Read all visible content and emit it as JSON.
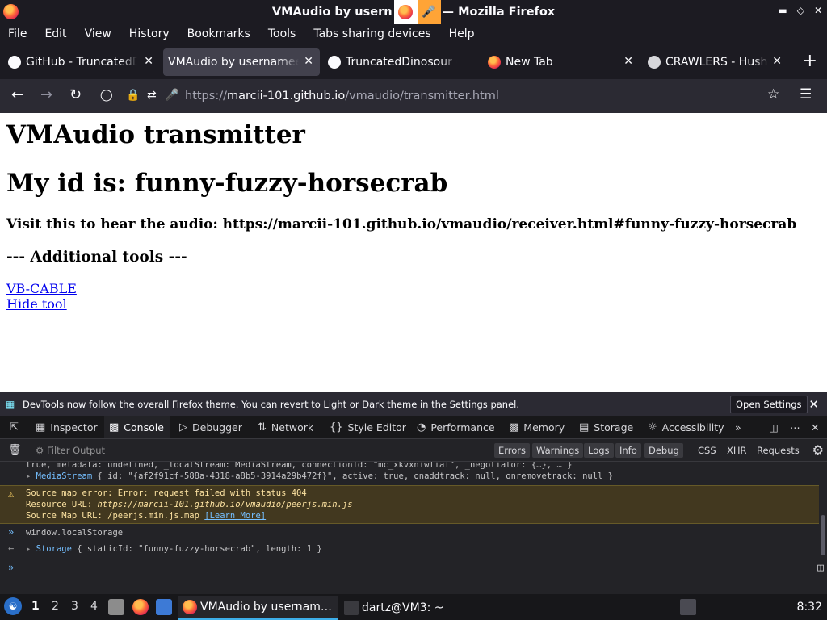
{
  "window": {
    "title_left": "VMAudio by usern",
    "title_right": "— Mozilla Firefox",
    "minimize": "•",
    "maximize": "•",
    "close": "✕"
  },
  "menu": [
    "File",
    "Edit",
    "View",
    "History",
    "Bookmarks",
    "Tools",
    "Tabs sharing devices",
    "Help"
  ],
  "tabs": [
    {
      "label": "GitHub - TruncatedDi",
      "icon": "github-icon",
      "active": false
    },
    {
      "label": "VMAudio by usernamee",
      "icon": "none",
      "active": true
    },
    {
      "label": "TruncatedDinosour (T",
      "icon": "github-icon",
      "active": false
    },
    {
      "label": "New Tab",
      "icon": "firefox-icon",
      "active": false
    },
    {
      "label": "CRAWLERS - Hush (O",
      "icon": "site-icon",
      "active": false
    }
  ],
  "url": {
    "scheme": "https://",
    "host": "marcii-101.github.io",
    "path": "/vmaudio/transmitter.html"
  },
  "page": {
    "heading": "VMAudio transmitter",
    "id_line": "My id is: funny-fuzzy-horsecrab",
    "visit_line": "Visit this to hear the audio: https://marcii-101.github.io/vmaudio/receiver.html#funny-fuzzy-horsecrab",
    "tools_heading": "--- Additional tools ---",
    "link_vbcable": "VB-CABLE",
    "link_hide": "Hide tool"
  },
  "devtools": {
    "notice": "DevTools now follow the overall Firefox theme. You can revert to Light or Dark theme in the Settings panel.",
    "open_settings": "Open Settings",
    "tabs": [
      "Inspector",
      "Console",
      "Debugger",
      "Network",
      "Style Editor",
      "Performance",
      "Memory",
      "Storage",
      "Accessibility"
    ],
    "active_tab": "Console",
    "filter_placeholder": "Filter Output",
    "filter_levels": [
      "Errors",
      "Warnings",
      "Logs",
      "Info",
      "Debug"
    ],
    "filter_extra": [
      "CSS",
      "XHR",
      "Requests"
    ],
    "console": {
      "line1": "true, metadata: undefined, _localStream: MediaStream, connectionId: \"mc_xkvxniwfiaf\", _negotiator: {…}, … }",
      "line2_type": "MediaStream",
      "line2_rest": "{ id: \"{af2f91cf-588a-4318-a8b5-3914a29b472f}\", active: true, onaddtrack: null, onremovetrack: null }",
      "warn_title": "Source map error: Error: request failed with status 404",
      "warn_resource_label": "Resource URL: ",
      "warn_resource": "https://marcii-101.github.io/vmaudio/peerjs.min.js",
      "warn_map": "Source Map URL: /peerjs.min.js.map ",
      "warn_learn": "[Learn More]",
      "input": "window.localStorage",
      "result_type": "Storage",
      "result_rest": "{ staticId: \"funny-fuzzy-horsecrab\", length: 1 }"
    }
  },
  "taskbar": {
    "workspaces": [
      "1",
      "2",
      "3",
      "4"
    ],
    "active_window": "VMAudio by usernam…",
    "terminal": "dartz@VM3: ~",
    "clock": "8:32"
  }
}
